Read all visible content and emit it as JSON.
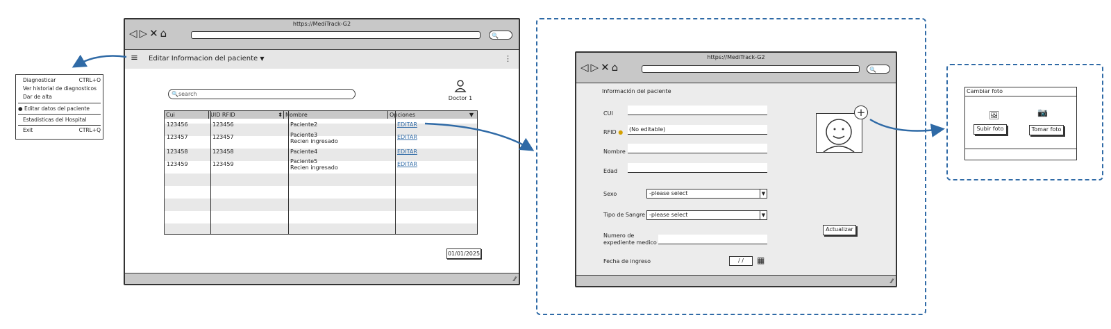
{
  "main_window": {
    "url": "https://MediTrack-G2",
    "nav_icons": "◁▷✕⌂",
    "toolbar_title": "Editar Informacion del paciente",
    "kebab": "⋮",
    "search_placeholder": "search",
    "user_label": "Doctor 1",
    "columns": [
      "Cui",
      "UID RFID",
      "Nombre",
      "Opciones"
    ],
    "rows": [
      {
        "cui": "123456",
        "rfid": "123456",
        "nombre": "Paciente2",
        "nombre2": "",
        "opcion": "EDITAR"
      },
      {
        "cui": "123457",
        "rfid": "123457",
        "nombre": "Paciente3",
        "nombre2": "Recien ingresado",
        "opcion": "EDITAR"
      },
      {
        "cui": "123458",
        "rfid": "123458",
        "nombre": "Paciente4",
        "nombre2": "",
        "opcion": "EDITAR"
      },
      {
        "cui": "123459",
        "rfid": "123459",
        "nombre": "Paciente5",
        "nombre2": "Recien ingresado",
        "opcion": "EDITAR"
      }
    ],
    "date": "01/01/2025"
  },
  "menu": {
    "items": [
      {
        "label": "Diagnosticar",
        "shortcut": "CTRL+O"
      },
      {
        "label": "Ver historial de diagnosticos",
        "shortcut": ""
      },
      {
        "label": "Dar de alta",
        "shortcut": ""
      },
      {
        "label": "Editar datos del paciente",
        "shortcut": ""
      },
      {
        "label": "Estadisticas del Hospital",
        "shortcut": ""
      },
      {
        "label": "Exit",
        "shortcut": "CTRL+Q"
      }
    ]
  },
  "form_window": {
    "url": "https://MediTrack-G2",
    "nav_icons": "◁▷✕⌂",
    "section_title": "Información del paciente",
    "cui_label": "CUI",
    "rfid_label": "RFID",
    "rfid_value": "(No editable)",
    "nombre_label": "Nombre",
    "edad_label": "Edad",
    "sexo_label": "Sexo",
    "sexo_value": "-please select",
    "sangre_label": "Tipo de Sangre",
    "sangre_value": "-please select",
    "expediente_label_1": "Numero de",
    "expediente_label_2": "expediente medico",
    "fecha_label": "Fecha de ingreso",
    "fecha_value": "/ /",
    "update_button": "Actualizar"
  },
  "photo_dialog": {
    "title": "Cambiar foto",
    "upload_button": "Subir foto",
    "take_button": "Tomar foto"
  },
  "colors": {
    "accent": "#2f6aa6",
    "toolbar": "#e6e6e6",
    "titlebar": "#c8c8c8"
  }
}
